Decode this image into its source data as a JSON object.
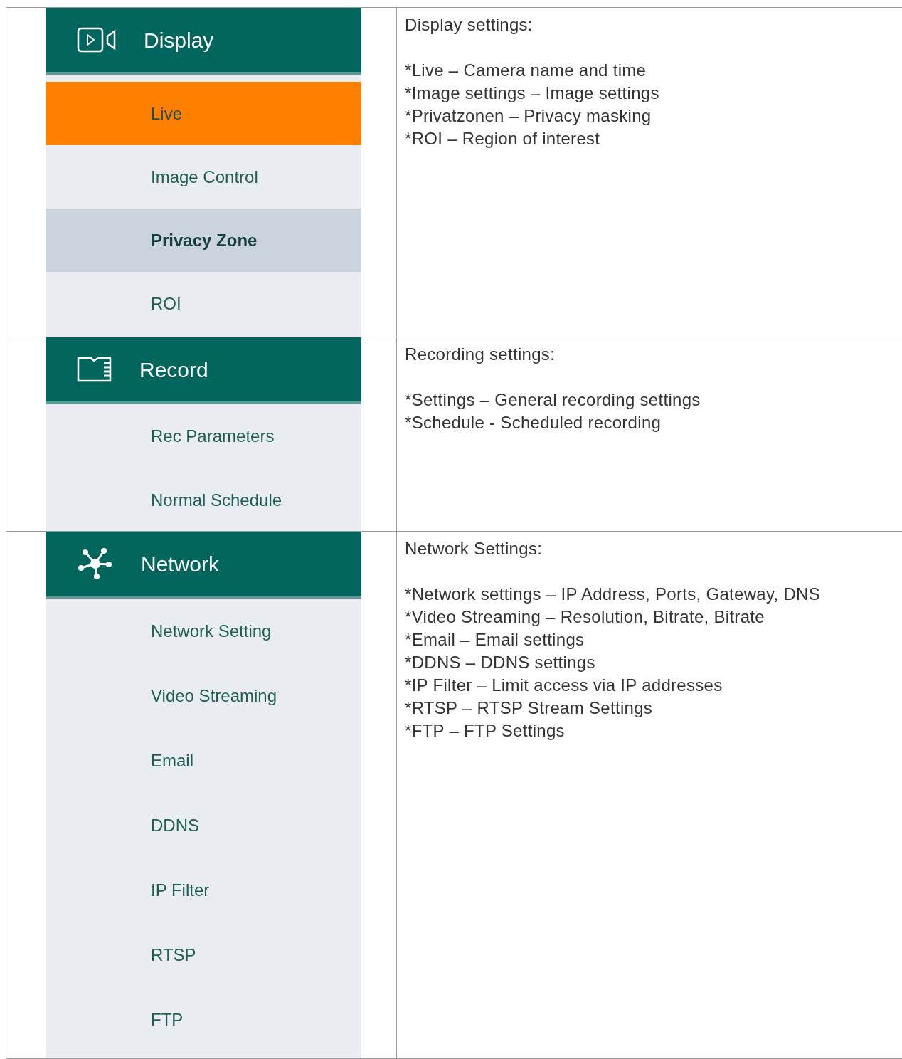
{
  "rows": [
    {
      "menu": {
        "title": "Display",
        "items": [
          {
            "label": "Live",
            "selected": true,
            "hovered": false
          },
          {
            "label": "Image Control",
            "selected": false,
            "hovered": false
          },
          {
            "label": "Privacy Zone",
            "selected": false,
            "hovered": true
          },
          {
            "label": "ROI",
            "selected": false,
            "hovered": false
          }
        ]
      },
      "description": {
        "heading": "Display settings:",
        "lines": [
          "*Live – Camera name and time",
          "*Image settings – Image settings",
          "*Privatzonen – Privacy masking",
          "*ROI – Region of interest"
        ]
      }
    },
    {
      "menu": {
        "title": "Record",
        "items": [
          {
            "label": "Rec Parameters",
            "selected": false,
            "hovered": false
          },
          {
            "label": "Normal Schedule",
            "selected": false,
            "hovered": false
          }
        ]
      },
      "description": {
        "heading": "Recording settings:",
        "lines": [
          "*Settings – General recording settings",
          "*Schedule - Scheduled recording"
        ]
      }
    },
    {
      "menu": {
        "title": "Network",
        "items": [
          {
            "label": "Network Setting",
            "selected": false,
            "hovered": false
          },
          {
            "label": "Video Streaming",
            "selected": false,
            "hovered": false
          },
          {
            "label": "Email",
            "selected": false,
            "hovered": false
          },
          {
            "label": "DDNS",
            "selected": false,
            "hovered": false
          },
          {
            "label": "IP Filter",
            "selected": false,
            "hovered": false
          },
          {
            "label": "RTSP",
            "selected": false,
            "hovered": false
          },
          {
            "label": "FTP",
            "selected": false,
            "hovered": false
          }
        ]
      },
      "description": {
        "heading": "Network Settings:",
        "lines": [
          "*Network settings – IP Address, Ports, Gateway, DNS",
          "*Video Streaming – Resolution, Bitrate, Bitrate",
          "*Email – Email settings",
          "*DDNS – DDNS settings",
          "*IP Filter – Limit access via IP addresses",
          "*RTSP – RTSP Stream Settings",
          "*FTP – FTP Settings"
        ]
      }
    }
  ]
}
